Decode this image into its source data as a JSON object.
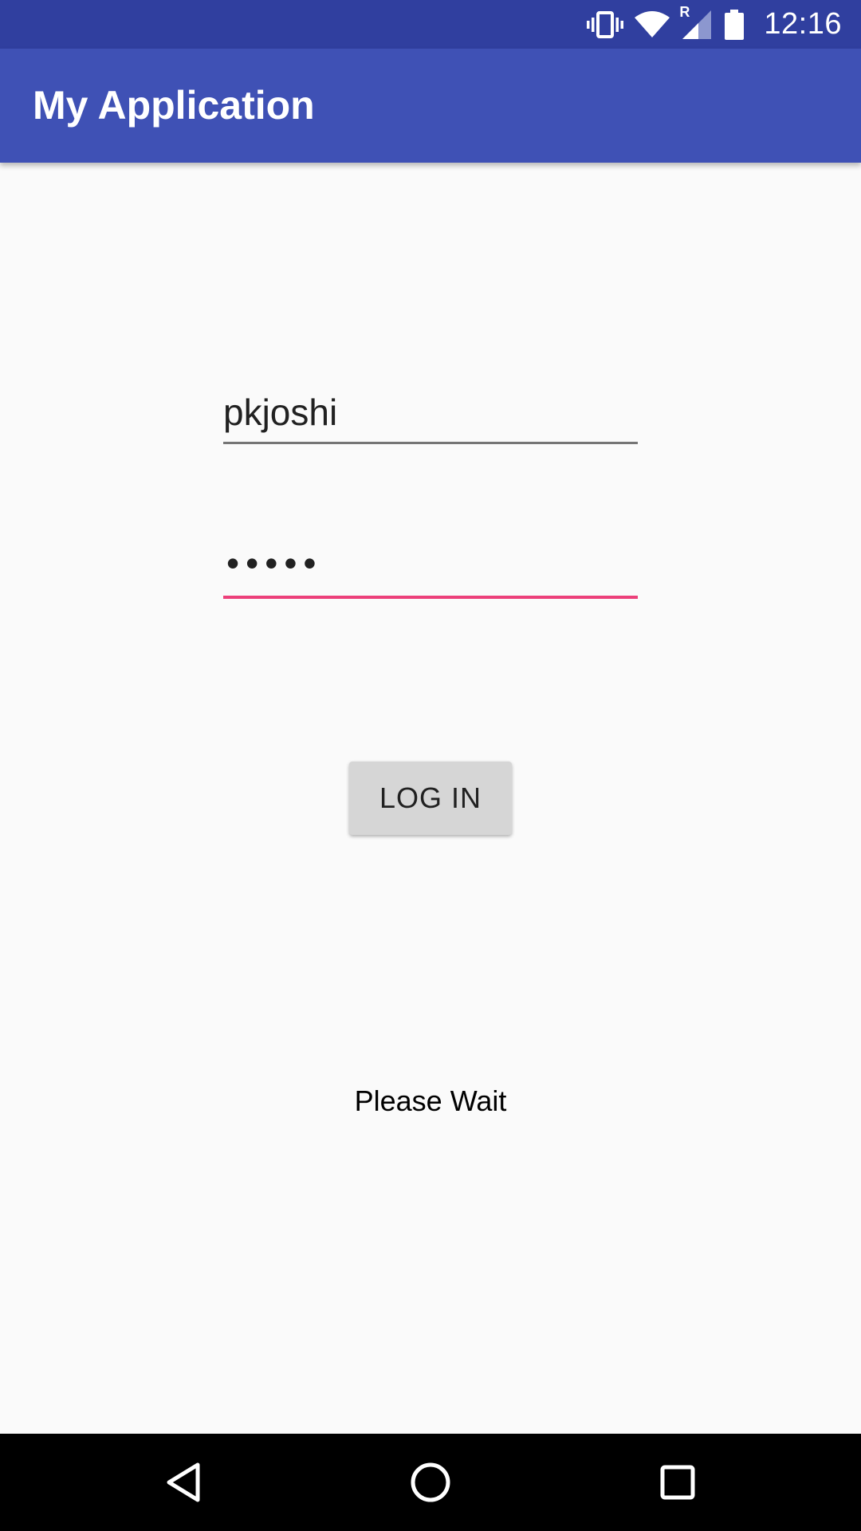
{
  "status_bar": {
    "time": "12:16",
    "icons": [
      "vibrate-icon",
      "wifi-icon",
      "cell-signal-roaming-icon",
      "battery-icon"
    ],
    "roaming_label": "R",
    "background_color": "#303F9F"
  },
  "app_bar": {
    "title": "My Application",
    "background_color": "#3F51B5"
  },
  "login_form": {
    "username_value": "pkjoshi",
    "password_value": "•••••",
    "focused_field_accent_color": "#EC407A",
    "login_button_label": "LOG IN"
  },
  "status_message": "Please Wait",
  "nav_bar": {
    "buttons": [
      "back-icon",
      "home-icon",
      "recents-icon"
    ]
  }
}
